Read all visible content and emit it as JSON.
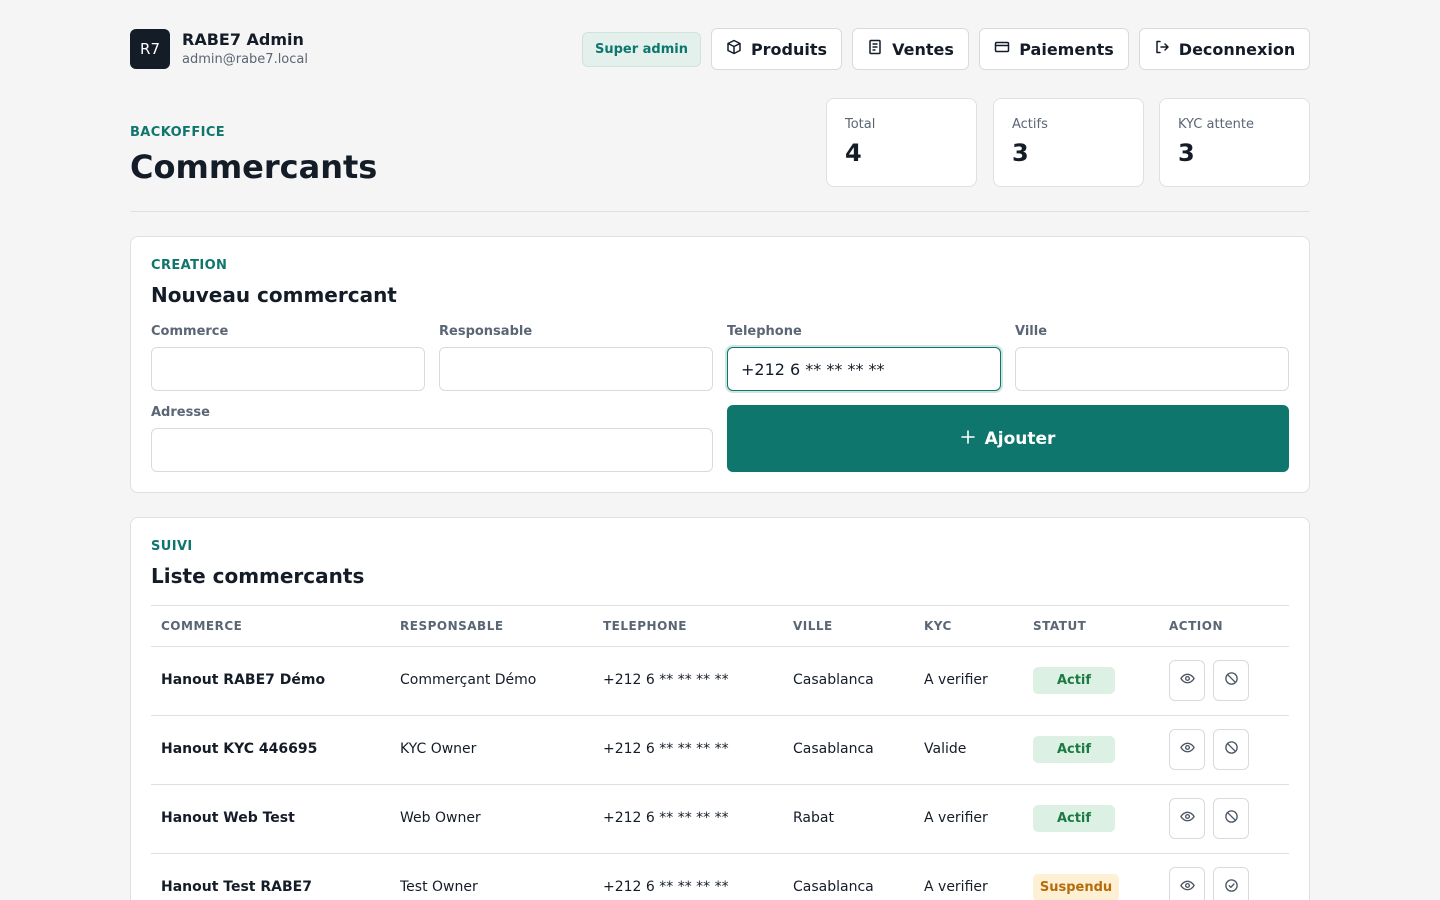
{
  "header": {
    "logo_text": "R7",
    "user_name": "RABE7 Admin",
    "user_email": "admin@rabe7.local",
    "role_badge": "Super admin",
    "nav": [
      {
        "label": "Produits",
        "icon": "box-icon"
      },
      {
        "label": "Ventes",
        "icon": "receipt-icon"
      },
      {
        "label": "Paiements",
        "icon": "card-icon"
      },
      {
        "label": "Deconnexion",
        "icon": "logout-icon"
      }
    ]
  },
  "page": {
    "eyebrow": "BACKOFFICE",
    "title": "Commercants"
  },
  "stats": [
    {
      "label": "Total",
      "value": "4"
    },
    {
      "label": "Actifs",
      "value": "3"
    },
    {
      "label": "KYC attente",
      "value": "3"
    }
  ],
  "create": {
    "eyebrow": "CREATION",
    "title": "Nouveau commercant",
    "fields": {
      "commerce": {
        "label": "Commerce",
        "value": ""
      },
      "responsable": {
        "label": "Responsable",
        "value": ""
      },
      "telephone": {
        "label": "Telephone",
        "value": "+212 6 ** ** ** **"
      },
      "ville": {
        "label": "Ville",
        "value": ""
      },
      "adresse": {
        "label": "Adresse",
        "value": ""
      }
    },
    "add_button": "Ajouter"
  },
  "list": {
    "eyebrow": "SUIVI",
    "title": "Liste commercants",
    "columns": [
      "COMMERCE",
      "RESPONSABLE",
      "TELEPHONE",
      "VILLE",
      "KYC",
      "STATUT",
      "ACTION"
    ],
    "rows": [
      {
        "commerce": "Hanout RABE7 Démo",
        "responsable": "Commerçant Démo",
        "telephone": "+212 6 ** ** ** **",
        "ville": "Casablanca",
        "kyc": "A verifier",
        "statut": "Actif",
        "status_type": "active"
      },
      {
        "commerce": "Hanout KYC 446695",
        "responsable": "KYC Owner",
        "telephone": "+212 6 ** ** ** **",
        "ville": "Casablanca",
        "kyc": "Valide",
        "statut": "Actif",
        "status_type": "active"
      },
      {
        "commerce": "Hanout Web Test",
        "responsable": "Web Owner",
        "telephone": "+212 6 ** ** ** **",
        "ville": "Rabat",
        "kyc": "A verifier",
        "statut": "Actif",
        "status_type": "active"
      },
      {
        "commerce": "Hanout Test RABE7",
        "responsable": "Test Owner",
        "telephone": "+212 6 ** ** ** **",
        "ville": "Casablanca",
        "kyc": "A verifier",
        "statut": "Suspendu",
        "status_type": "suspended"
      }
    ]
  },
  "colors": {
    "accent": "#0f766e",
    "background": "#f4f5f4",
    "text": "#141c28",
    "muted": "#5b6675",
    "active_bg": "#dcf1e4",
    "suspended_bg": "#fdf0d4"
  }
}
